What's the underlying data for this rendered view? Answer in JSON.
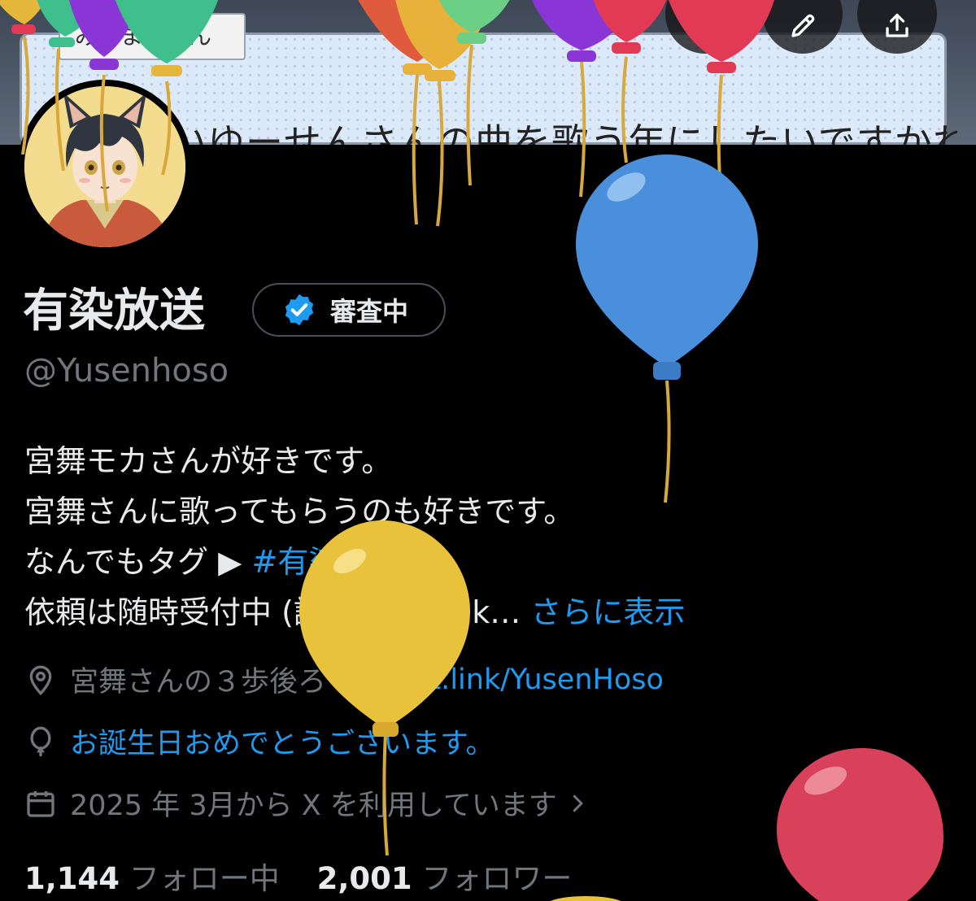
{
  "banner": {
    "name_tag": "みやまいさん",
    "caption": "いっぱいゆーせんさんの曲を歌う年にしたいですかね"
  },
  "header": {
    "buttons": [
      {
        "icon": "search-icon"
      },
      {
        "icon": "edit-icon"
      },
      {
        "icon": "share-icon"
      }
    ]
  },
  "profile": {
    "display_name": "有染放送",
    "badge_label": "審査中",
    "handle": "@Yusenhoso",
    "bio": {
      "line1": "宮舞モカさんが好きです。",
      "line2": "宮舞さんに歌ってもらうのも好きです。",
      "line3_text": "なんでもタグ ▶︎ ",
      "line3_hashtag": "#有染LAN",
      "line4_text": "依頼は随時受付中 (詳細は lit link… ",
      "line4_more": "さらに表示"
    },
    "location": "宮舞さんの３歩後ろ",
    "website": "lit.link/YusenHoso",
    "birthday": "お誕生日おめでとうございます。",
    "joined": "2025 年 3月から X を利用しています",
    "following_count": "1,144",
    "following_label": "フォロー中",
    "followers_count": "2,001",
    "followers_label": "フォロワー"
  },
  "colors": {
    "background": "#000000",
    "text": "#e7e9ea",
    "muted": "#71767b",
    "link": "#1d9bf0",
    "verified_badge": "#1d9bf0",
    "balloon_blue": "#4a8fdc",
    "balloon_yellow": "#e9c23c",
    "balloon_red": "#d9415a"
  }
}
